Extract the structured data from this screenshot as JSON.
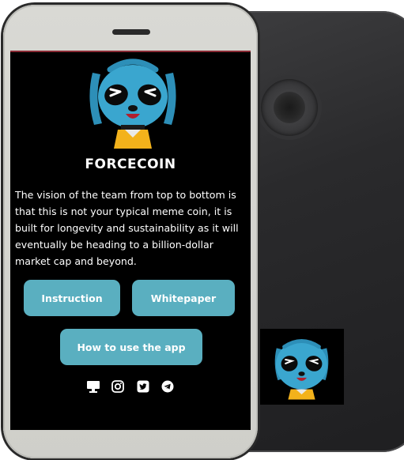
{
  "app": {
    "title": "FORCECOIN",
    "description": "The vision of the team from top to bottom is that this is not your typical meme coin, it is built for longevity and sustainability as it will eventually be heading to a billion-dollar market cap and beyond."
  },
  "buttons": {
    "instruction": "Instruction",
    "whitepaper": "Whitepaper",
    "how_to": "How to use the app"
  },
  "socials": [
    "desktop-icon",
    "instagram-icon",
    "twitter-icon",
    "telegram-icon"
  ],
  "colors": {
    "screen_bg": "#000000",
    "button": "#5aafc0",
    "mascot_blue": "#3aa6cf",
    "front_frame": "#d6d6d1",
    "back_phone": "#2e2e30"
  }
}
